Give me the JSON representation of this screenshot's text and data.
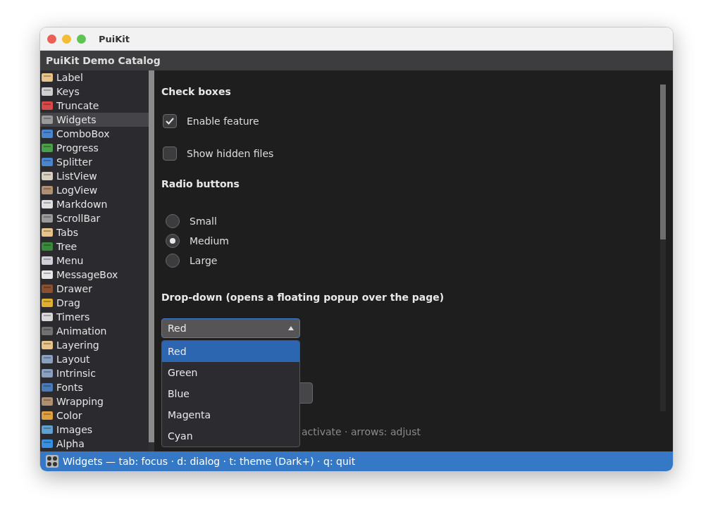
{
  "window": {
    "title": "PuiKit"
  },
  "header": {
    "title": "PuiKit Demo Catalog"
  },
  "sidebar": {
    "items": [
      {
        "label": "Label",
        "selected": false
      },
      {
        "label": "Keys",
        "selected": false
      },
      {
        "label": "Truncate",
        "selected": false
      },
      {
        "label": "Widgets",
        "selected": true
      },
      {
        "label": "ComboBox",
        "selected": false
      },
      {
        "label": "Progress",
        "selected": false
      },
      {
        "label": "Splitter",
        "selected": false
      },
      {
        "label": "ListView",
        "selected": false
      },
      {
        "label": "LogView",
        "selected": false
      },
      {
        "label": "Markdown",
        "selected": false
      },
      {
        "label": "ScrollBar",
        "selected": false
      },
      {
        "label": "Tabs",
        "selected": false
      },
      {
        "label": "Tree",
        "selected": false
      },
      {
        "label": "Menu",
        "selected": false
      },
      {
        "label": "MessageBox",
        "selected": false
      },
      {
        "label": "Drawer",
        "selected": false
      },
      {
        "label": "Drag",
        "selected": false
      },
      {
        "label": "Timers",
        "selected": false
      },
      {
        "label": "Animation",
        "selected": false
      },
      {
        "label": "Layering",
        "selected": false
      },
      {
        "label": "Layout",
        "selected": false
      },
      {
        "label": "Intrinsic",
        "selected": false
      },
      {
        "label": "Fonts",
        "selected": false
      },
      {
        "label": "Wrapping",
        "selected": false
      },
      {
        "label": "Color",
        "selected": false
      },
      {
        "label": "Images",
        "selected": false
      },
      {
        "label": "Alpha",
        "selected": false
      }
    ]
  },
  "sections": [
    {
      "title": "Check boxes",
      "kind": "checkboxes",
      "items": [
        {
          "label": "Enable feature",
          "checked": true
        },
        {
          "label": "Show hidden files",
          "checked": false
        }
      ]
    },
    {
      "title": "Radio buttons",
      "kind": "radios",
      "items": [
        {
          "label": "Small",
          "selected": false
        },
        {
          "label": "Medium",
          "selected": true
        },
        {
          "label": "Large",
          "selected": false
        }
      ]
    },
    {
      "title": "Drop-down (opens a floating popup over the page)",
      "kind": "dropdown",
      "value": "Red",
      "expanded": true,
      "options": [
        {
          "label": "Red",
          "selected": true
        },
        {
          "label": "Green",
          "selected": false
        },
        {
          "label": "Blue",
          "selected": false
        },
        {
          "label": "Magenta",
          "selected": false
        },
        {
          "label": "Cyan",
          "selected": false
        }
      ],
      "hint": "activate · arrows: adjust"
    }
  ],
  "status_bar": {
    "text": "Widgets — tab: focus · d: dialog · t: theme (Dark+) · q: quit"
  }
}
